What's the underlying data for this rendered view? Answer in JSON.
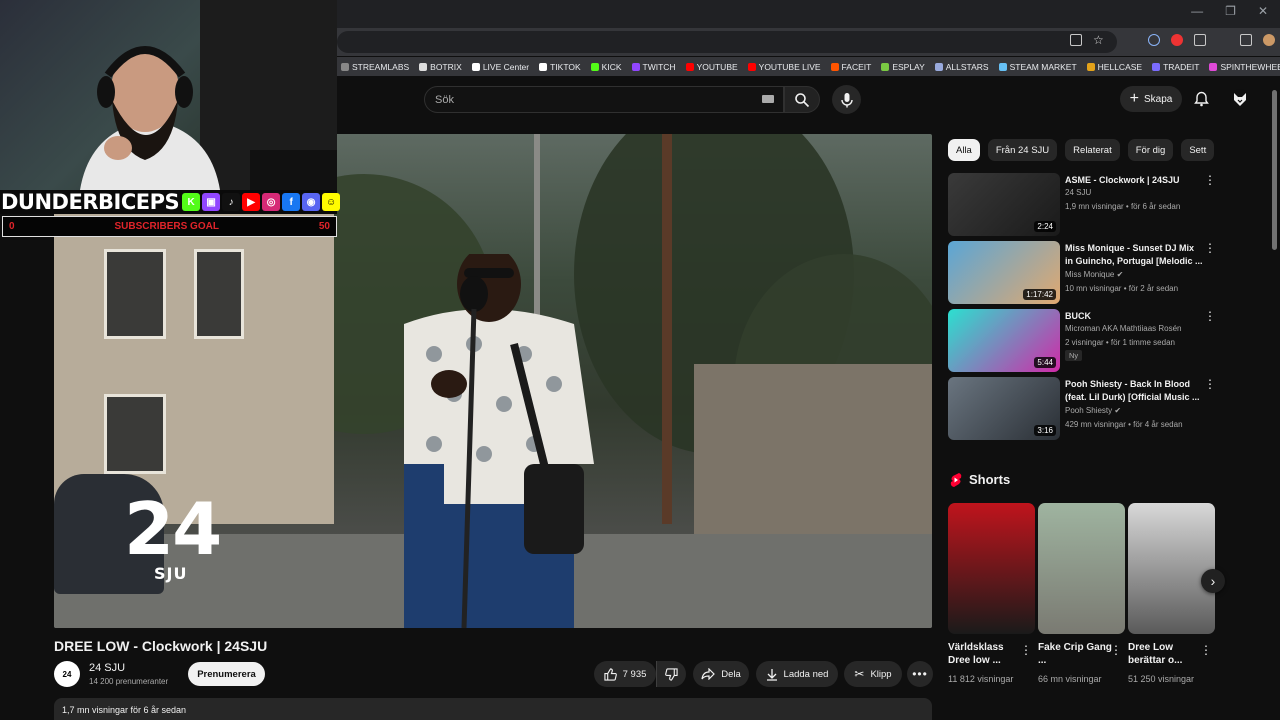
{
  "browser": {
    "bookmarks": [
      {
        "label": "STREAMLABS",
        "color": "#888888"
      },
      {
        "label": "BOTRIX",
        "color": "#dddddd"
      },
      {
        "label": "LIVE Center",
        "color": "#ffffff"
      },
      {
        "label": "TIKTOK",
        "color": "#ffffff"
      },
      {
        "label": "KICK",
        "color": "#53fc18"
      },
      {
        "label": "TWITCH",
        "color": "#9146ff"
      },
      {
        "label": "YOUTUBE",
        "color": "#ff0000"
      },
      {
        "label": "YOUTUBE LIVE",
        "color": "#ff0000"
      },
      {
        "label": "FACEIT",
        "color": "#ff5500"
      },
      {
        "label": "ESPLAY",
        "color": "#7ac943"
      },
      {
        "label": "ALLSTARS",
        "color": "#9ad"
      },
      {
        "label": "STEAM MARKET",
        "color": "#66c0f4"
      },
      {
        "label": "HELLCASE",
        "color": "#e3a21a"
      },
      {
        "label": "TRADEIT",
        "color": "#7b6cff"
      },
      {
        "label": "SPINTHEWHEEL",
        "color": "#e04ad8"
      }
    ],
    "more_icon": "chevron-double-right-icon"
  },
  "overlay": {
    "streamer_name": "DUNDERBICEPS",
    "socials": [
      {
        "icon": "kick-icon",
        "glyph": "K",
        "color": "#53fc18"
      },
      {
        "icon": "twitch-icon",
        "glyph": "▣",
        "color": "#9146ff"
      },
      {
        "icon": "tiktok-icon",
        "glyph": "♪",
        "color": "#111111"
      },
      {
        "icon": "youtube-icon",
        "glyph": "▶",
        "color": "#ff0000"
      },
      {
        "icon": "instagram-icon",
        "glyph": "◎",
        "color": "#d62976"
      },
      {
        "icon": "facebook-icon",
        "glyph": "f",
        "color": "#1877f2"
      },
      {
        "icon": "discord-icon",
        "glyph": "◉",
        "color": "#5865f2"
      },
      {
        "icon": "snapchat-icon",
        "glyph": "☺",
        "color": "#fffc00"
      }
    ],
    "goal_current": "0",
    "goal_label": "SUBSCRIBERS GOAL",
    "goal_target": "50",
    "goal_progress": 0
  },
  "header": {
    "search_placeholder": "Sök",
    "create_label": "Skapa"
  },
  "video": {
    "overlay_logo_big": "24",
    "overlay_logo_small": "SJU",
    "title": "DREE LOW - Clockwork | 24SJU",
    "channel": {
      "name": "24 SJU",
      "subscribers": "14 200 prenumeranter",
      "avatar_text": "24"
    },
    "subscribe_label": "Prenumerera",
    "likes": "7 935",
    "share_label": "Dela",
    "download_label": "Ladda ned",
    "clip_label": "Klipp",
    "description_meta": "1,7 mn visningar  för 6 år sedan"
  },
  "sidebar": {
    "chips": [
      {
        "label": "Alla",
        "active": true
      },
      {
        "label": "Från 24 SJU",
        "active": false
      },
      {
        "label": "Relaterat",
        "active": false
      },
      {
        "label": "För dig",
        "active": false
      },
      {
        "label": "Sett",
        "active": false
      }
    ],
    "recommendations": [
      {
        "title": "ASME - Clockwork | 24SJU",
        "channel": "24 SJU",
        "verified": false,
        "meta": "1,9 mn visningar • för 6 år sedan",
        "duration": "2:24",
        "badge": "",
        "thumb": [
          "#3a3a3a",
          "#1a1a1a"
        ]
      },
      {
        "title": "Miss Monique - Sunset DJ Mix in Guincho, Portugal [Melodic ...",
        "channel": "Miss Monique",
        "verified": true,
        "meta": "10 mn visningar • för 2 år sedan",
        "duration": "1:17:42",
        "badge": "",
        "thumb": [
          "#5aa6d6",
          "#e0a870"
        ]
      },
      {
        "title": "BUCK",
        "channel": "Microman AKA Mathtiiaas Rosén",
        "verified": false,
        "meta": "2 visningar • för 1 timme sedan",
        "duration": "5:44",
        "badge": "Ny",
        "thumb": [
          "#2be0d0",
          "#d02aa8"
        ]
      },
      {
        "title": "Pooh Shiesty - Back In Blood (feat. Lil Durk) [Official Music ...",
        "channel": "Pooh Shiesty",
        "verified": true,
        "meta": "429 mn visningar • för 4 år sedan",
        "duration": "3:16",
        "badge": "",
        "thumb": [
          "#6a7580",
          "#2a2f35"
        ]
      }
    ],
    "shorts_heading": "Shorts",
    "shorts": [
      {
        "title": "Världsklass Dree low ...",
        "views": "11 812 visningar",
        "thumb": [
          "#c0141c",
          "#1a1a1a"
        ]
      },
      {
        "title": "Fake Crip Gang ...",
        "views": "66 mn visningar",
        "thumb": [
          "#9fb4a0",
          "#7a7a72"
        ]
      },
      {
        "title": "Dree Low berättar o...",
        "views": "51 250 visningar",
        "thumb": [
          "#d8d8d8",
          "#5a5a5a"
        ]
      }
    ]
  }
}
